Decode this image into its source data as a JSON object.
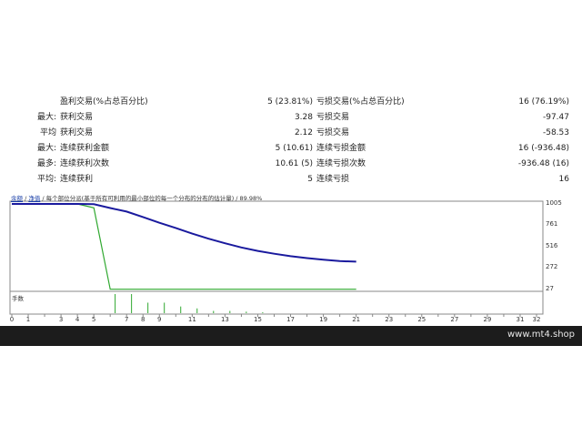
{
  "stats": [
    {
      "prefix": "",
      "label1": "盈利交易(%占总百分比)",
      "value1": "5 (23.81%)",
      "label2": "亏损交易(%占总百分比)",
      "value2": "16 (76.19%)"
    },
    {
      "prefix": "最大:",
      "label1": "获利交易",
      "value1": "3.28",
      "label2": "亏损交易",
      "value2": "-97.47"
    },
    {
      "prefix": "平均",
      "label1": "获利交易",
      "value1": "2.12",
      "label2": "亏损交易",
      "value2": "-58.53"
    },
    {
      "prefix": "最大:",
      "label1": "连续获利金额",
      "value1": "5 (10.61)",
      "label2": "连续亏损金额",
      "value2": "16 (-936.48)"
    },
    {
      "prefix": "最多:",
      "label1": "连续获利次数",
      "value1": "10.61 (5)",
      "label2": "连续亏损次数",
      "value2": "-936.48 (16)"
    },
    {
      "prefix": "平均:",
      "label1": "连续获利",
      "value1": "5",
      "label2": "连续亏损",
      "value2": "16"
    }
  ],
  "chart": {
    "header_link1": "余额",
    "header_sep1": " / ",
    "header_link2": "净值",
    "header_sep2": " / ",
    "header_text": "每个部位分派(基于所有可利用的最小部位的每一个分布的分布的估计量) / 89.98%",
    "histogram_label": "手数",
    "colors": {
      "balance": "#1a1a9e",
      "equity": "#2fa82f",
      "histogram": "#2fa82f"
    }
  },
  "chart_data": {
    "type": "line",
    "x_ticks": [
      0,
      1,
      2,
      3,
      4,
      5,
      6,
      7,
      8,
      9,
      10,
      11,
      12,
      13,
      14,
      15,
      16,
      17,
      18,
      19,
      20,
      21,
      22,
      23,
      24,
      25,
      26,
      27,
      28,
      29,
      30,
      31,
      32
    ],
    "x_tick_labels": [
      "0",
      "1",
      "3",
      "4",
      "5",
      "7",
      "8",
      "9",
      "11",
      "13",
      "15",
      "17",
      "19",
      "21",
      "23",
      "25",
      "27",
      "29",
      "31",
      "32"
    ],
    "y_tick_labels": [
      "1005",
      "761",
      "516",
      "272",
      "27"
    ],
    "ylim": [
      27,
      1005
    ],
    "series": [
      {
        "values_x": [
          0,
          4,
          5,
          6,
          7,
          8,
          9,
          10,
          11,
          12,
          13,
          14,
          15,
          16,
          17,
          18,
          19,
          20,
          21
        ],
        "values": [
          1005,
          1005,
          1002,
          958,
          918,
          855,
          790,
          730,
          666,
          608,
          556,
          508,
          468,
          436,
          408,
          386,
          368,
          352,
          345
        ]
      },
      {
        "values_x": [
          0,
          4,
          5,
          6,
          21
        ],
        "values": [
          1005,
          1005,
          960,
          30,
          30
        ]
      }
    ],
    "histogram": {
      "x": [
        6,
        7,
        8,
        9,
        10,
        11,
        12,
        13,
        14,
        15
      ],
      "values": [
        1.0,
        1.0,
        0.55,
        0.55,
        0.35,
        0.25,
        0.12,
        0.12,
        0.08,
        0.05
      ]
    }
  },
  "footer": {
    "site": "www.mt4.shop"
  }
}
